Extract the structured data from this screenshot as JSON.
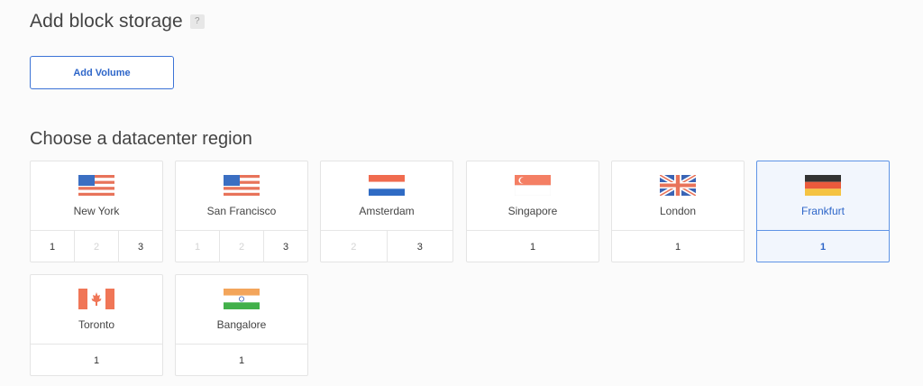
{
  "block_storage": {
    "title": "Add block storage",
    "help_label": "?",
    "add_volume_label": "Add Volume"
  },
  "region": {
    "title": "Choose a datacenter region",
    "regions": [
      {
        "name": "New York",
        "flag": "us-flag-icon",
        "options": [
          {
            "label": "1",
            "enabled": true
          },
          {
            "label": "2",
            "enabled": false
          },
          {
            "label": "3",
            "enabled": true
          }
        ]
      },
      {
        "name": "San Francisco",
        "flag": "us-flag-icon",
        "options": [
          {
            "label": "1",
            "enabled": false
          },
          {
            "label": "2",
            "enabled": false
          },
          {
            "label": "3",
            "enabled": true
          }
        ]
      },
      {
        "name": "Amsterdam",
        "flag": "netherlands-flag-icon",
        "options": [
          {
            "label": "2",
            "enabled": false
          },
          {
            "label": "3",
            "enabled": true
          }
        ]
      },
      {
        "name": "Singapore",
        "flag": "singapore-flag-icon",
        "options": [
          {
            "label": "1",
            "enabled": true
          }
        ]
      },
      {
        "name": "London",
        "flag": "uk-flag-icon",
        "options": [
          {
            "label": "1",
            "enabled": true
          }
        ]
      },
      {
        "name": "Frankfurt",
        "flag": "germany-flag-icon",
        "selected": true,
        "options": [
          {
            "label": "1",
            "enabled": true
          }
        ]
      },
      {
        "name": "Toronto",
        "flag": "canada-flag-icon",
        "options": [
          {
            "label": "1",
            "enabled": true
          }
        ]
      },
      {
        "name": "Bangalore",
        "flag": "india-flag-icon",
        "options": [
          {
            "label": "1",
            "enabled": true
          }
        ]
      }
    ]
  },
  "colors": {
    "accent": "#2e66c9",
    "selected_border": "#5f94e6",
    "selected_bg": "#f2f6fd"
  }
}
